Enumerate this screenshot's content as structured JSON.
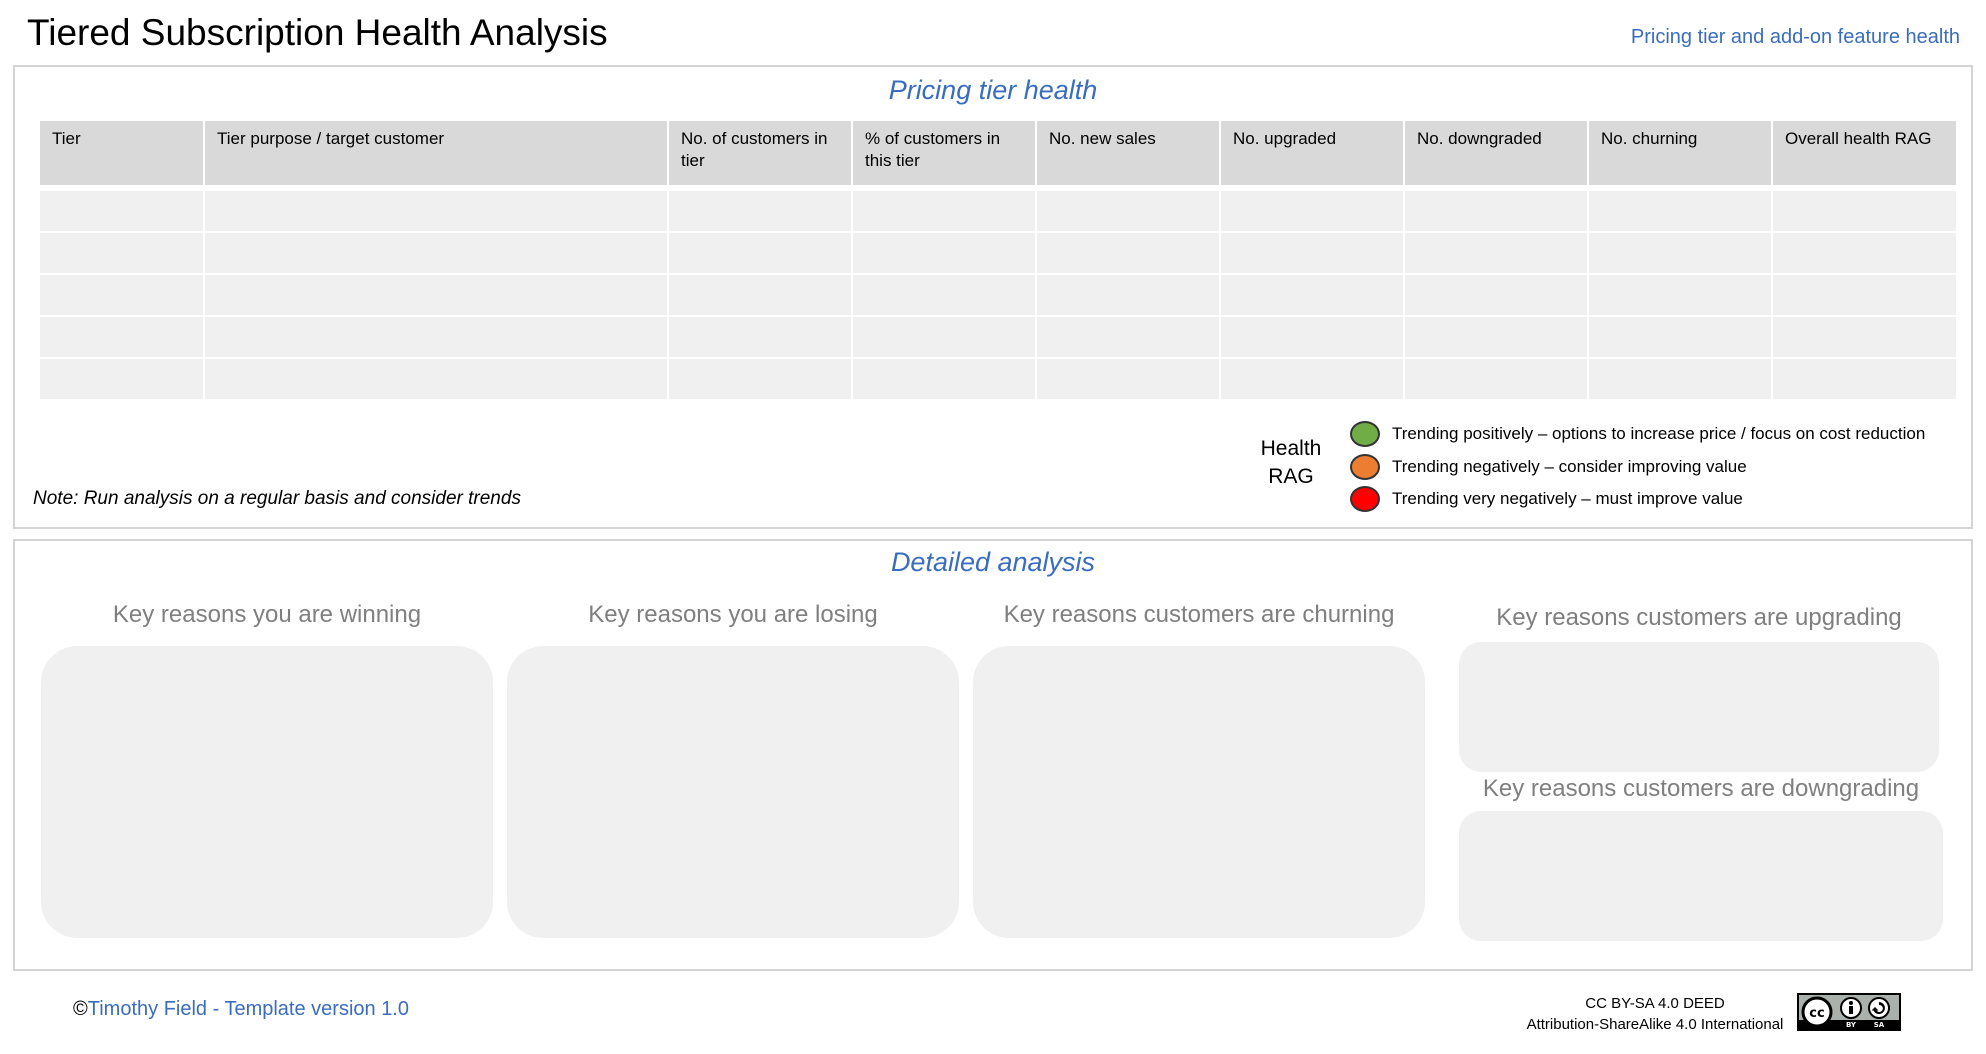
{
  "header": {
    "title": "Tiered Subscription Health Analysis",
    "subtitle": "Pricing tier and add-on feature health"
  },
  "pricing_section": {
    "heading": "Pricing tier health",
    "columns": [
      "Tier",
      "Tier purpose / target customer",
      "No. of customers in tier",
      "% of customers in this tier",
      "No. new sales",
      "No. upgraded",
      "No. downgraded",
      "No. churning",
      "Overall health RAG"
    ],
    "row_count": 5,
    "note": "Note: Run analysis on a regular basis and consider trends"
  },
  "legend": {
    "label_line1": "Health",
    "label_line2": "RAG",
    "items": [
      {
        "color": "#70ad47",
        "text": "Trending positively – options to increase price / focus on cost reduction"
      },
      {
        "color": "#ed7d31",
        "text": "Trending negatively – consider improving value"
      },
      {
        "color": "#ff0000",
        "text": "Trending very negatively – must improve value"
      }
    ]
  },
  "detailed_section": {
    "heading": "Detailed analysis",
    "winning": "Key reasons you are winning",
    "losing": "Key reasons you are losing",
    "churning": "Key reasons customers are churning",
    "upgrading": "Key reasons customers are upgrading",
    "downgrading": "Key reasons customers are downgrading"
  },
  "footer": {
    "copyright_symbol": "©",
    "author": "Timothy Field - Template version 1.0",
    "license_line1": "CC BY-SA 4.0 DEED",
    "license_line2": "Attribution-ShareAlike 4.0 International",
    "badge_icon": "cc-by-sa-icon",
    "badge_text_by": "BY",
    "badge_text_sa": "SA"
  }
}
